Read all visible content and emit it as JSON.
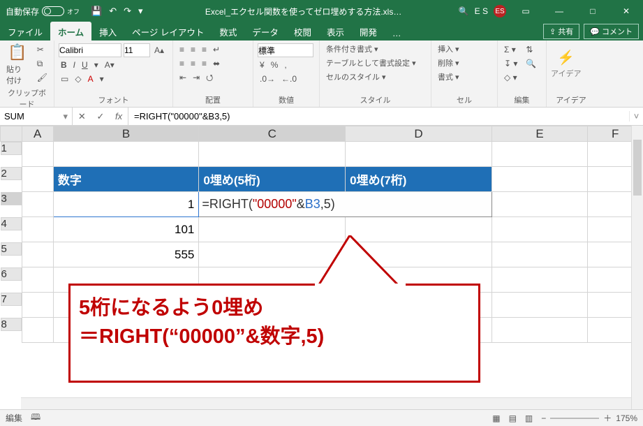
{
  "titlebar": {
    "autosave_label": "自動保存",
    "autosave_state": "オフ",
    "filename": "Excel_エクセル関数を使ってゼロ埋めする方法.xls…",
    "search_icon": "🔍",
    "user_initials": "ES",
    "user_text": "E S",
    "window_btns": {
      "ribbon": "▭",
      "min": "—",
      "max": "□",
      "close": "✕"
    }
  },
  "tabs": {
    "items": [
      "ファイル",
      "ホーム",
      "挿入",
      "ページ レイアウト",
      "数式",
      "データ",
      "校閲",
      "表示",
      "開発",
      "…"
    ],
    "active_index": 1,
    "share": "共有",
    "comment": "コメント"
  },
  "ribbon": {
    "clipboard": {
      "paste": "貼り付け",
      "label": "クリップボード"
    },
    "font": {
      "name": "Calibri",
      "size": "11",
      "row1": [
        "B",
        "I",
        "U",
        "▾"
      ],
      "row2": [
        "▭",
        "◇",
        "A",
        "▾"
      ],
      "label": "フォント"
    },
    "align": {
      "label": "配置"
    },
    "number": {
      "style": "標準",
      "label": "数値"
    },
    "styles": {
      "cond": "条件付き書式 ▾",
      "table": "テーブルとして書式設定 ▾",
      "cell": "セルのスタイル ▾",
      "label": "スタイル"
    },
    "cells": {
      "insert": "挿入  ▾",
      "delete": "削除  ▾",
      "format": "書式 ▾",
      "label": "セル"
    },
    "editing": {
      "label": "編集"
    },
    "ideas": {
      "btn": "アイデア",
      "label": "アイデア"
    }
  },
  "formula_bar": {
    "namebox": "SUM",
    "cancel": "✕",
    "enter": "✓",
    "fx": "fx",
    "formula": "=RIGHT(\"00000\"&B3,5)"
  },
  "sheet": {
    "cols": [
      "A",
      "B",
      "C",
      "D",
      "E",
      "F"
    ],
    "rows": [
      "1",
      "2",
      "3",
      "4",
      "5",
      "6",
      "7",
      "8"
    ],
    "headers": {
      "b2": "数字",
      "c2": "0埋め(5桁)",
      "d2": "0埋め(7桁)"
    },
    "b3": "1",
    "c3_pre": "=RIGHT(",
    "c3_str": "\"00000\"",
    "c3_amp": "&",
    "c3_ref": "B3",
    "c3_post": ",5)",
    "b4": "101",
    "b5": "555"
  },
  "callout": {
    "line1": "5桁になるよう0埋め",
    "line2": "＝RIGHT(“00000”&数字,5)"
  },
  "statusbar": {
    "mode": "編集",
    "zoom": "175%"
  }
}
